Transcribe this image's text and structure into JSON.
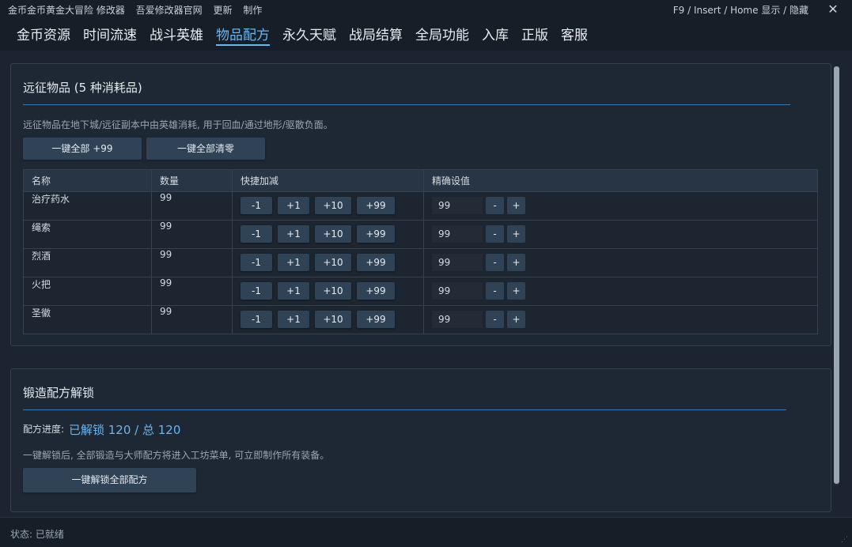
{
  "title_bar": {
    "app_title": "金币金币黄金大冒险 修改器",
    "links": [
      "吾爱修改器官网",
      "更新",
      "制作"
    ],
    "hotkey_hint": "F9 / Insert / Home  显示 / 隐藏",
    "close_glyph": "✕"
  },
  "tabs": [
    {
      "label": "金币资源"
    },
    {
      "label": "时间流速"
    },
    {
      "label": "战斗英雄"
    },
    {
      "label": "物品配方"
    },
    {
      "label": "永久天赋"
    },
    {
      "label": "战局结算"
    },
    {
      "label": "全局功能"
    },
    {
      "label": "入库"
    },
    {
      "label": "正版"
    },
    {
      "label": "客服"
    }
  ],
  "active_tab": "物品配方",
  "expedition": {
    "title": "远征物品 (5 种消耗品)",
    "description": "远征物品在地下城/远征副本中由英雄消耗, 用于回血/通过地形/驱散负面。",
    "btn_all_99": "一键全部 +99",
    "btn_clear_all": "一键全部清零",
    "table": {
      "headers": [
        "名称",
        "数量",
        "快捷加减",
        "精确设值"
      ],
      "quick_buttons": [
        "-1",
        "+1",
        "+10",
        "+99"
      ],
      "minus": "-",
      "plus": "+",
      "rows": [
        {
          "name": "治疗药水",
          "qty": "99",
          "set_value": "99"
        },
        {
          "name": "绳索",
          "qty": "99",
          "set_value": "99"
        },
        {
          "name": "烈酒",
          "qty": "99",
          "set_value": "99"
        },
        {
          "name": "火把",
          "qty": "99",
          "set_value": "99"
        },
        {
          "name": "圣徽",
          "qty": "99",
          "set_value": "99"
        }
      ]
    }
  },
  "forge": {
    "title": "锻造配方解锁",
    "progress_label": "配方进度:",
    "progress_value": "已解锁 120 / 总 120",
    "description": "一键解锁后, 全部锻造与大师配方将进入工坊菜单, 可立即制作所有装备。",
    "unlock_btn": "一键解锁全部配方"
  },
  "status": {
    "text": "状态: 已就绪",
    "grip": "⋰"
  },
  "colors": {
    "background": "#1b2430",
    "panel": "#1e2834",
    "accent": "#6cb4ee",
    "button": "#2f4256"
  }
}
